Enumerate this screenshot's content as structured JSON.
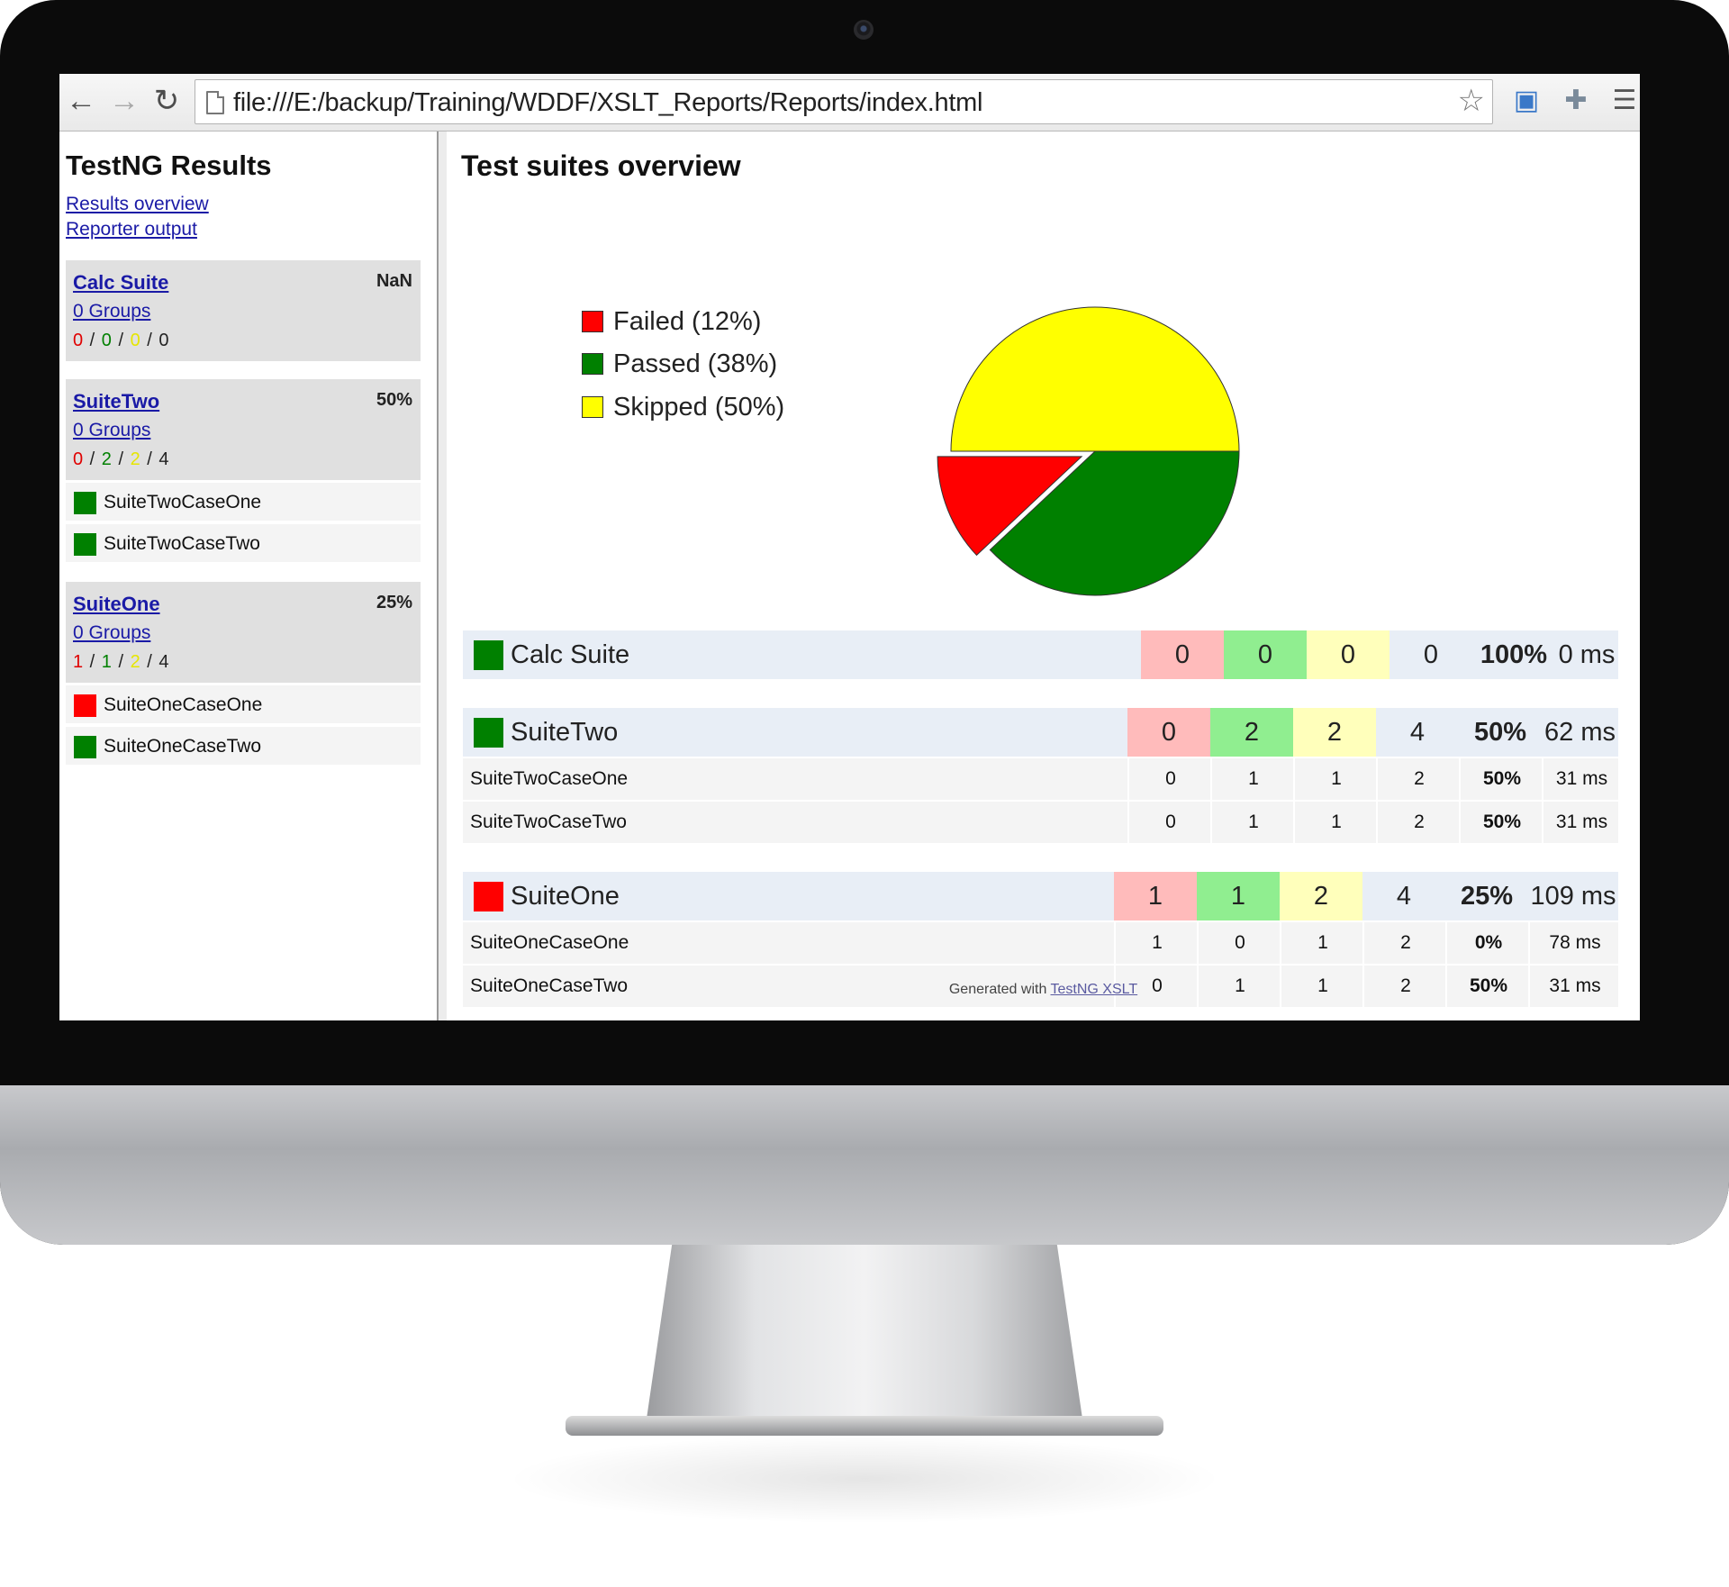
{
  "browser": {
    "url": "file:///E:/backup/Training/WDDF/XSLT_Reports/Reports/index.html"
  },
  "sidebar": {
    "title": "TestNG Results",
    "links": [
      "Results overview",
      "Reporter output"
    ],
    "suites": [
      {
        "name": "Calc Suite",
        "pct": "NaN",
        "groups": "0 Groups",
        "counts": {
          "failed": "0",
          "passed": "0",
          "skipped": "0",
          "total": "0"
        },
        "cases": []
      },
      {
        "name": "SuiteTwo",
        "pct": "50%",
        "groups": "0 Groups",
        "counts": {
          "failed": "0",
          "passed": "2",
          "skipped": "2",
          "total": "4"
        },
        "cases": [
          {
            "name": "SuiteTwoCaseOne",
            "status": "passed"
          },
          {
            "name": "SuiteTwoCaseTwo",
            "status": "passed"
          }
        ]
      },
      {
        "name": "SuiteOne",
        "pct": "25%",
        "groups": "0 Groups",
        "counts": {
          "failed": "1",
          "passed": "1",
          "skipped": "2",
          "total": "4"
        },
        "cases": [
          {
            "name": "SuiteOneCaseOne",
            "status": "failed"
          },
          {
            "name": "SuiteOneCaseTwo",
            "status": "passed"
          }
        ]
      }
    ]
  },
  "main": {
    "title": "Test suites overview",
    "footer_prefix": "Generated with",
    "footer_link": "TestNG XSLT"
  },
  "chart_data": {
    "type": "pie",
    "title": "",
    "slices": [
      {
        "label": "Failed (12%)",
        "value": 12,
        "color": "#ff0000"
      },
      {
        "label": "Passed (38%)",
        "value": 38,
        "color": "#008000"
      },
      {
        "label": "Skipped (50%)",
        "value": 50,
        "color": "#ffff00"
      }
    ],
    "legend_position": "left"
  },
  "table": {
    "suites": [
      {
        "name": "Calc Suite",
        "status": "passed",
        "failed": "0",
        "passed": "0",
        "skipped": "0",
        "total": "0",
        "pct": "100%",
        "time": "0 ms",
        "cases": []
      },
      {
        "name": "SuiteTwo",
        "status": "passed",
        "failed": "0",
        "passed": "2",
        "skipped": "2",
        "total": "4",
        "pct": "50%",
        "time": "62 ms",
        "cases": [
          {
            "name": "SuiteTwoCaseOne",
            "failed": "0",
            "passed": "1",
            "skipped": "1",
            "total": "2",
            "pct": "50%",
            "time": "31 ms"
          },
          {
            "name": "SuiteTwoCaseTwo",
            "failed": "0",
            "passed": "1",
            "skipped": "1",
            "total": "2",
            "pct": "50%",
            "time": "31 ms"
          }
        ]
      },
      {
        "name": "SuiteOne",
        "status": "failed",
        "failed": "1",
        "passed": "1",
        "skipped": "2",
        "total": "4",
        "pct": "25%",
        "time": "109 ms",
        "cases": [
          {
            "name": "SuiteOneCaseOne",
            "failed": "1",
            "passed": "0",
            "skipped": "1",
            "total": "2",
            "pct": "0%",
            "time": "78 ms"
          },
          {
            "name": "SuiteOneCaseTwo",
            "failed": "0",
            "passed": "1",
            "skipped": "1",
            "total": "2",
            "pct": "50%",
            "time": "31 ms"
          }
        ]
      }
    ]
  },
  "colors": {
    "passed": "#008000",
    "failed": "#ff0000",
    "skipped": "#ffff00"
  }
}
